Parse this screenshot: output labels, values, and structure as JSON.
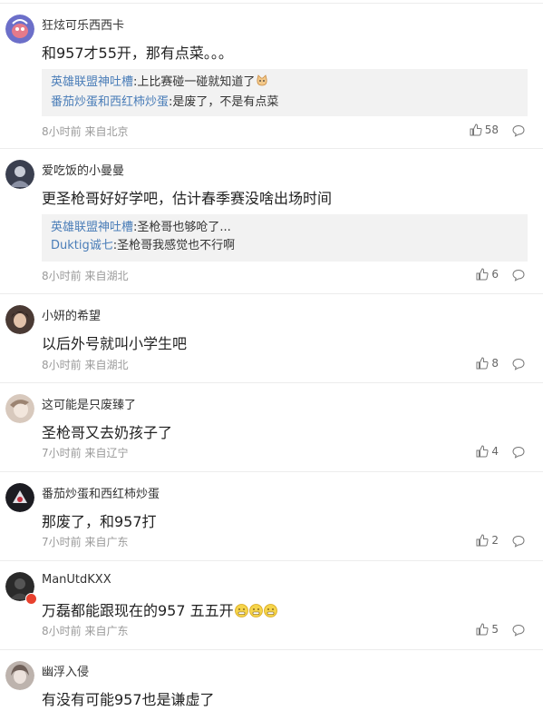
{
  "comments": [
    {
      "username": "狂炫可乐西西卡",
      "content": "和957才55开，那有点菜。。。",
      "replies": [
        {
          "author": "英雄联盟神吐槽",
          "sep": ":",
          "text": "上比赛碰一碰就知道了"
        },
        {
          "author": "番茄炒蛋和西红柿炒蛋",
          "sep": ":",
          "text": "是废了，不是有点菜"
        }
      ],
      "meta": "8小时前 来自北京",
      "likes": "58",
      "like_icon": "thumbs-up-icon",
      "comment_icon": "comment-bubble-icon",
      "avatar_color": "#6c6fc9"
    },
    {
      "username": "爱吃饭的小曼曼",
      "content": "更圣枪哥好好学吧，估计春季赛没啥出场时间",
      "replies": [
        {
          "author": "英雄联盟神吐槽",
          "sep": ":",
          "text": "圣枪哥也够呛了..."
        },
        {
          "author": "Duktig诚七",
          "sep": ":",
          "text": "圣枪哥我感觉也不行啊"
        }
      ],
      "meta": "8小时前 来自湖北",
      "likes": "6",
      "avatar_color": "#3a3f4f"
    },
    {
      "username": "小妍的希望",
      "content": "以后外号就叫小学生吧",
      "meta": "8小时前 来自湖北",
      "likes": "8",
      "avatar_color": "#4a3a34"
    },
    {
      "username": "这可能是只废臻了",
      "content": "圣枪哥又去奶孩子了",
      "meta": "7小时前 来自辽宁",
      "likes": "4",
      "avatar_color": "#d8c9bd"
    },
    {
      "username": "番茄炒蛋和西红柿炒蛋",
      "content": "那废了，和957打",
      "meta": "7小时前 来自广东",
      "likes": "2",
      "avatar_color": "#1c1c22"
    },
    {
      "username": "ManUtdKXX",
      "content": "万磊都能跟现在的957 五五开",
      "meta": "8小时前 来自广东",
      "likes": "5",
      "avatar_color": "#2a2a2a"
    },
    {
      "username": "幽浮入侵",
      "content": "有没有可能957也是谦虚了",
      "avatar_color": "#bdb3ad"
    }
  ],
  "colors": {
    "reply_author": "#4a7db8",
    "meta": "#9a9a9a",
    "reply_bg": "#f2f2f2",
    "divider": "#ececec"
  }
}
